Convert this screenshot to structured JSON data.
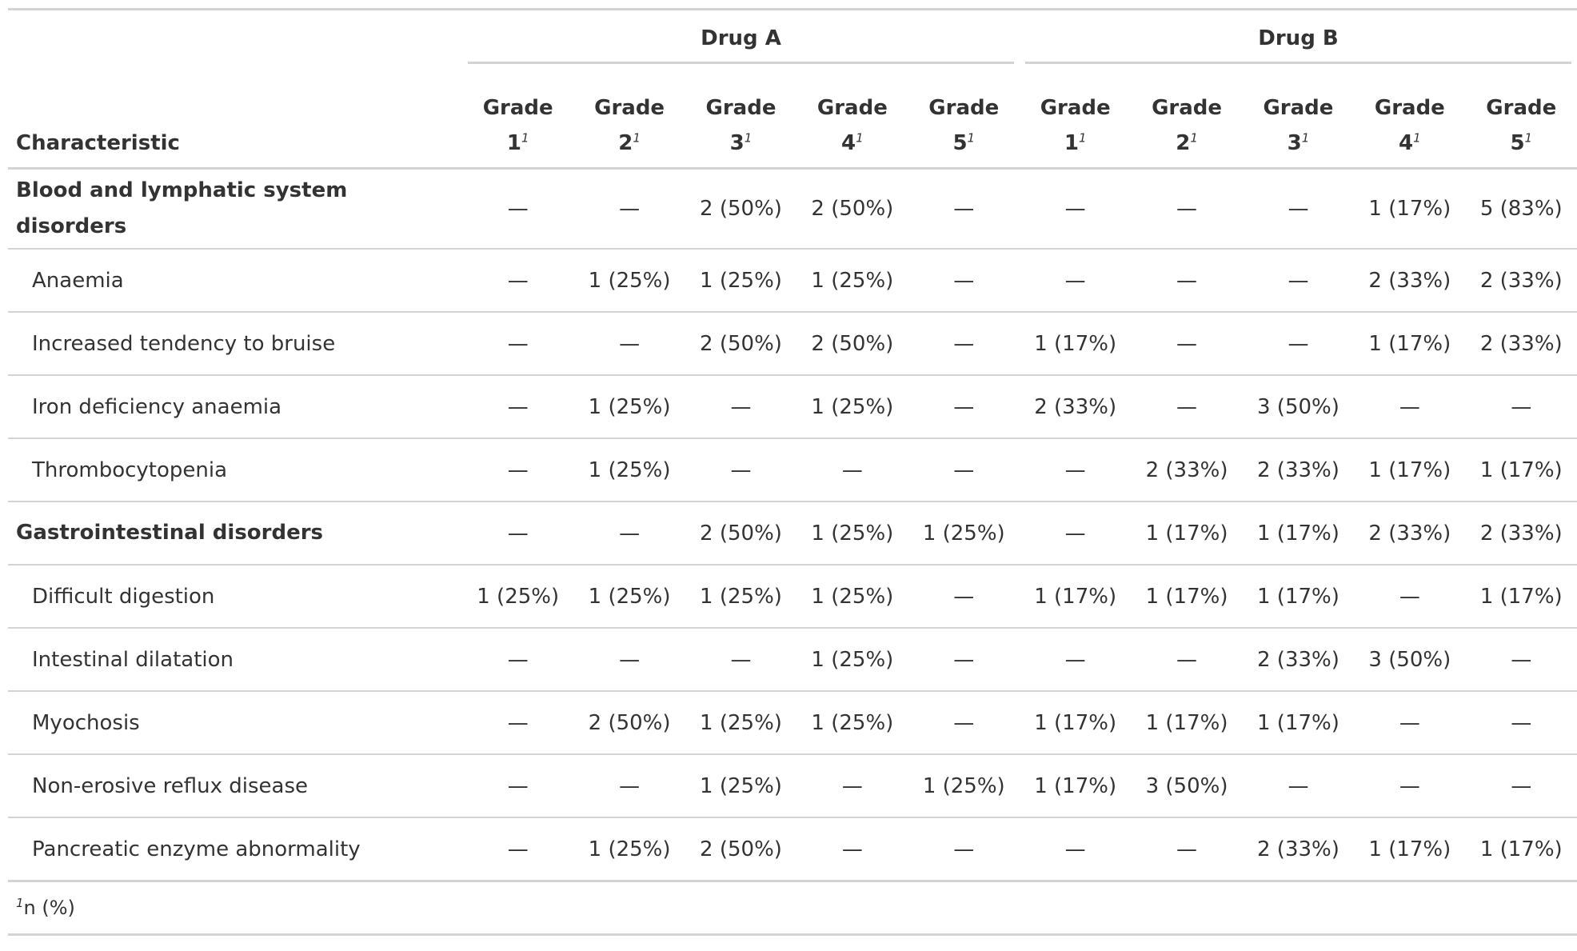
{
  "table": {
    "stub_header": "Characteristic",
    "spanners": [
      "Drug A",
      "Drug B"
    ],
    "columns": [
      {
        "line1": "Grade",
        "line2": "1",
        "footnote_mark": "1"
      },
      {
        "line1": "Grade",
        "line2": "2",
        "footnote_mark": "1"
      },
      {
        "line1": "Grade",
        "line2": "3",
        "footnote_mark": "1"
      },
      {
        "line1": "Grade",
        "line2": "4",
        "footnote_mark": "1"
      },
      {
        "line1": "Grade",
        "line2": "5",
        "footnote_mark": "1"
      },
      {
        "line1": "Grade",
        "line2": "1",
        "footnote_mark": "1"
      },
      {
        "line1": "Grade",
        "line2": "2",
        "footnote_mark": "1"
      },
      {
        "line1": "Grade",
        "line2": "3",
        "footnote_mark": "1"
      },
      {
        "line1": "Grade",
        "line2": "4",
        "footnote_mark": "1"
      },
      {
        "line1": "Grade",
        "line2": "5",
        "footnote_mark": "1"
      }
    ],
    "rows": [
      {
        "label": "Blood and lymphatic system disorders",
        "group": true,
        "cells": [
          "—",
          "—",
          "2 (50%)",
          "2 (50%)",
          "—",
          "—",
          "—",
          "—",
          "1 (17%)",
          "5 (83%)"
        ]
      },
      {
        "label": "Anaemia",
        "group": false,
        "cells": [
          "—",
          "1 (25%)",
          "1 (25%)",
          "1 (25%)",
          "—",
          "—",
          "—",
          "—",
          "2 (33%)",
          "2 (33%)"
        ]
      },
      {
        "label": "Increased tendency to bruise",
        "group": false,
        "cells": [
          "—",
          "—",
          "2 (50%)",
          "2 (50%)",
          "—",
          "1 (17%)",
          "—",
          "—",
          "1 (17%)",
          "2 (33%)"
        ]
      },
      {
        "label": "Iron deficiency anaemia",
        "group": false,
        "cells": [
          "—",
          "1 (25%)",
          "—",
          "1 (25%)",
          "—",
          "2 (33%)",
          "—",
          "3 (50%)",
          "—",
          "—"
        ]
      },
      {
        "label": "Thrombocytopenia",
        "group": false,
        "cells": [
          "—",
          "1 (25%)",
          "—",
          "—",
          "—",
          "—",
          "2 (33%)",
          "2 (33%)",
          "1 (17%)",
          "1 (17%)"
        ]
      },
      {
        "label": "Gastrointestinal disorders",
        "group": true,
        "cells": [
          "—",
          "—",
          "2 (50%)",
          "1 (25%)",
          "1 (25%)",
          "—",
          "1 (17%)",
          "1 (17%)",
          "2 (33%)",
          "2 (33%)"
        ]
      },
      {
        "label": "Difficult digestion",
        "group": false,
        "cells": [
          "1 (25%)",
          "1 (25%)",
          "1 (25%)",
          "1 (25%)",
          "—",
          "1 (17%)",
          "1 (17%)",
          "1 (17%)",
          "—",
          "1 (17%)"
        ]
      },
      {
        "label": "Intestinal dilatation",
        "group": false,
        "cells": [
          "—",
          "—",
          "—",
          "1 (25%)",
          "—",
          "—",
          "—",
          "2 (33%)",
          "3 (50%)",
          "—"
        ]
      },
      {
        "label": "Myochosis",
        "group": false,
        "cells": [
          "—",
          "2 (50%)",
          "1 (25%)",
          "1 (25%)",
          "—",
          "1 (17%)",
          "1 (17%)",
          "1 (17%)",
          "—",
          "—"
        ]
      },
      {
        "label": "Non-erosive reflux disease",
        "group": false,
        "cells": [
          "—",
          "—",
          "1 (25%)",
          "—",
          "1 (25%)",
          "1 (17%)",
          "3 (50%)",
          "—",
          "—",
          "—"
        ]
      },
      {
        "label": "Pancreatic enzyme abnormality",
        "group": false,
        "cells": [
          "—",
          "1 (25%)",
          "2 (50%)",
          "—",
          "—",
          "—",
          "—",
          "2 (33%)",
          "1 (17%)",
          "1 (17%)"
        ]
      }
    ],
    "footnote": {
      "mark": "1",
      "text": "n (%)"
    }
  },
  "colors": {
    "text": "#333333",
    "rule": "#d3d3d3",
    "background": "#ffffff"
  }
}
